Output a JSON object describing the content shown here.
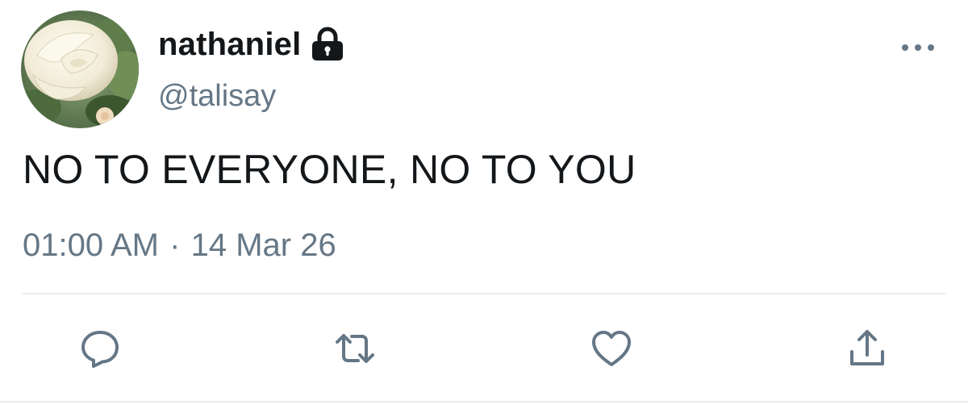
{
  "tweet": {
    "display_name": "nathaniel",
    "handle": "@talisay",
    "text": "NO TO EVERYONE, NO TO YOU",
    "time": "01:00 AM",
    "separator": "·",
    "date": "14 Mar 26",
    "avatar_description": "white rose"
  },
  "icons": {
    "lock": "lock-icon",
    "more": "more-icon",
    "reply": "reply-icon",
    "retweet": "retweet-icon",
    "like": "like-icon",
    "share": "share-icon"
  },
  "colors": {
    "text": "#14171a",
    "secondary": "#657786",
    "divider": "#e6ecf0"
  }
}
